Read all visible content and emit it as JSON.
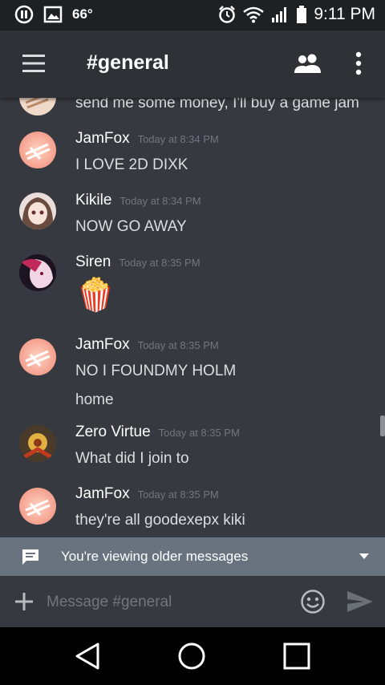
{
  "status_bar": {
    "temperature": "66°",
    "time": "9:11 PM"
  },
  "app_bar": {
    "channel": "#general"
  },
  "messages": [
    {
      "author": "",
      "timestamp": "",
      "text": "send me some money, I'll buy a game jam"
    },
    {
      "author": "JamFox",
      "timestamp": "Today at 8:34 PM",
      "text": "I LOVE 2D DIXK"
    },
    {
      "author": "Kikile",
      "timestamp": "Today at 8:34 PM",
      "text": "NOW GO AWAY"
    },
    {
      "author": "Siren",
      "timestamp": "Today at 8:35 PM",
      "emoji": "🍿"
    },
    {
      "author": "JamFox",
      "timestamp": "Today at 8:35 PM",
      "text": "NO I FOUNDMY HOLM",
      "text2": "home"
    },
    {
      "author": "Zero Virtue",
      "timestamp": "Today at 8:35 PM",
      "text": "What did I join to"
    },
    {
      "author": "JamFox",
      "timestamp": "Today at 8:35 PM",
      "text": "they're all goodexepx kiki"
    }
  ],
  "older_banner": {
    "text": "You're viewing older messages"
  },
  "composer": {
    "placeholder": "Message #general"
  },
  "icons": {
    "menu": "hamburger-icon",
    "members": "people-icon",
    "overflow": "more-vert-icon",
    "attach": "plus-icon",
    "emoji": "smiley-icon",
    "send": "send-icon",
    "nav_back": "back-triangle-icon",
    "nav_home": "home-circle-icon",
    "nav_recent": "recents-square-icon"
  },
  "colors": {
    "background": "#36393f",
    "app_bar": "#2f3136",
    "status_bar": "#1e2124",
    "banner": "#697380",
    "timestamp": "#72767d"
  }
}
